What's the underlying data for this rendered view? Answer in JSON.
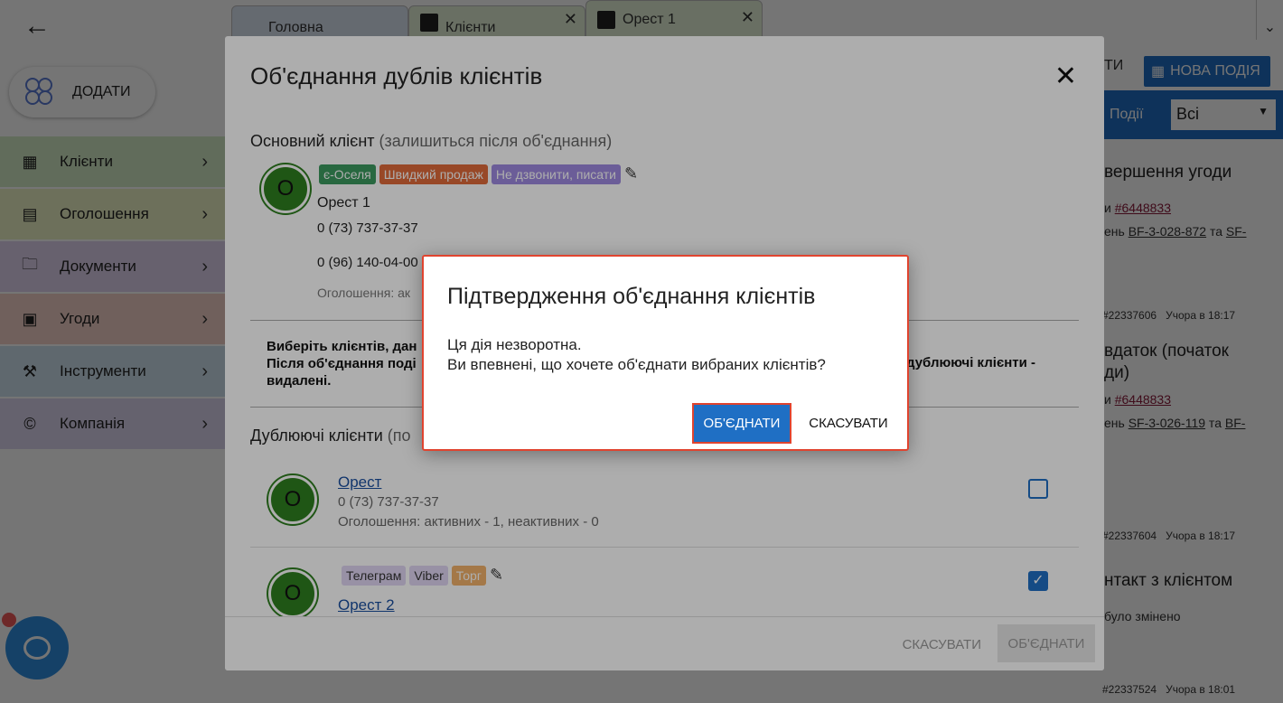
{
  "sidebar": {
    "add_label": "ДОДАТИ",
    "items": [
      {
        "label": "Клієнти",
        "color": "#d5ecc8",
        "icon": "contacts-icon"
      },
      {
        "label": "Оголошення",
        "color": "#eef5c8",
        "icon": "listing-icon"
      },
      {
        "label": "Документи",
        "color": "#e0d4ef",
        "icon": "folder-icon"
      },
      {
        "label": "Угоди",
        "color": "#f5d2c9",
        "icon": "deal-icon"
      },
      {
        "label": "Інструменти",
        "color": "#cfe3ef",
        "icon": "tools-icon"
      },
      {
        "label": "Компанія",
        "color": "#dcd6ef",
        "icon": "copyright-icon"
      }
    ]
  },
  "tabs": [
    {
      "label": "Головна"
    },
    {
      "label": "Клієнти"
    },
    {
      "label": "Орест 1"
    }
  ],
  "right": {
    "btn_left": "ТИ",
    "new_event": "НОВА ПОДІЯ",
    "filter_label": "Події",
    "filter_value": "Всі",
    "e1_title": "вершення угоди",
    "e1_l1a": "и ",
    "e1_link": "#6448833",
    "e1_l2a": "ень ",
    "e1_l2b": "BF-3-028-872",
    "e1_l2c": " та ",
    "e1_l2d": "SF-",
    "e1_meta1": "#22337606",
    "e1_meta2": "Учора в 18:17",
    "e2_title": "вдаток (початок",
    "e2_title2": "ди)",
    "e2_l1a": "и ",
    "e2_link": "#6448833",
    "e2_l2a": "ень ",
    "e2_l2b": "SF-3-026-119",
    "e2_l2c": " та ",
    "e2_l2d": "BF-",
    "e2_meta1": "#22337604",
    "e2_meta2": "Учора в 18:17",
    "e3_title": "нтакт з клієнтом",
    "e3_l1": "було змінено",
    "e3_meta1": "#22337524",
    "e3_meta2": "Учора в 18:01"
  },
  "dialog": {
    "title": "Об'єднання дублів клієнтів",
    "main_label": "Основний клієнт",
    "main_hint": "(залишиться після об'єднання)",
    "main": {
      "initial": "О",
      "tags": [
        "є-Оселя",
        "Швидкий продаж",
        "Не дзвонити, писати"
      ],
      "name": "Орест 1",
      "phone1": "0 (73) 737-37-37",
      "phone2": "0 (96) 140-04-00",
      "ads": "Оголошення: ак"
    },
    "instr1": "Виберіть клієнтів, дан",
    "instr2": "Після об'єднання поді",
    "instr3": "дублюючі клієнти -",
    "instr4": "видалені.",
    "dup_label": "Дублюючі клієнти",
    "dup_hint": "(по",
    "dups": [
      {
        "initial": "О",
        "name": "Орест",
        "phone": "0 (73) 737-37-37",
        "ads": "Оголошення: активних - 1, неактивних - 0",
        "checked": false
      },
      {
        "initial": "О",
        "tags": [
          "Телеграм",
          "Viber",
          "Торг"
        ],
        "name": "Орест 2",
        "checked": true
      }
    ],
    "footer_cancel": "СКАСУВАТИ",
    "footer_merge": "ОБ'ЄДНАТИ"
  },
  "confirm": {
    "title": "Підтвердження об'єднання клієнтів",
    "line1": "Ця дія незворотна.",
    "line2": "Ви впевнені, що хочете об'єднати вибраних клієнтів?",
    "ok": "ОБ'ЄДНАТИ",
    "cancel": "СКАСУВАТИ"
  }
}
